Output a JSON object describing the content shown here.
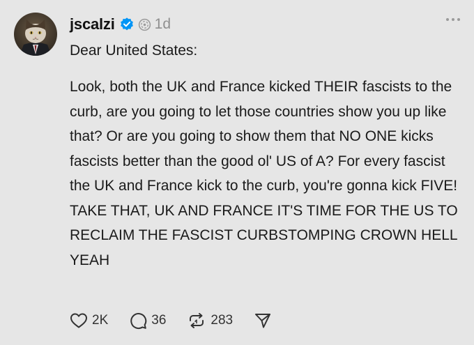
{
  "post": {
    "username": "jscalzi",
    "timestamp": "1d",
    "greeting": "Dear United States:",
    "body": "Look, both the UK and France kicked THEIR fascists to the curb, are you going to let those countries show you up like that? Or are you going to show them that NO ONE kicks fascists better than the good ol' US of A? For every fascist the UK and France kick to the curb, you're gonna kick FIVE! TAKE THAT, UK AND FRANCE IT'S TIME FOR THE US TO RECLAIM THE FASCIST CURBSTOMPING CROWN HELL YEAH"
  },
  "actions": {
    "likes": "2K",
    "replies": "36",
    "reposts": "283"
  },
  "icons": {
    "verified": "verified-badge-icon",
    "fediverse": "fediverse-icon",
    "more": "more-options-icon",
    "like": "heart-icon",
    "reply": "comment-icon",
    "repost": "repost-icon",
    "share": "send-icon"
  },
  "colors": {
    "background": "#e6e6e6",
    "verified": "#0095f6",
    "muted": "#8f8f8f"
  }
}
